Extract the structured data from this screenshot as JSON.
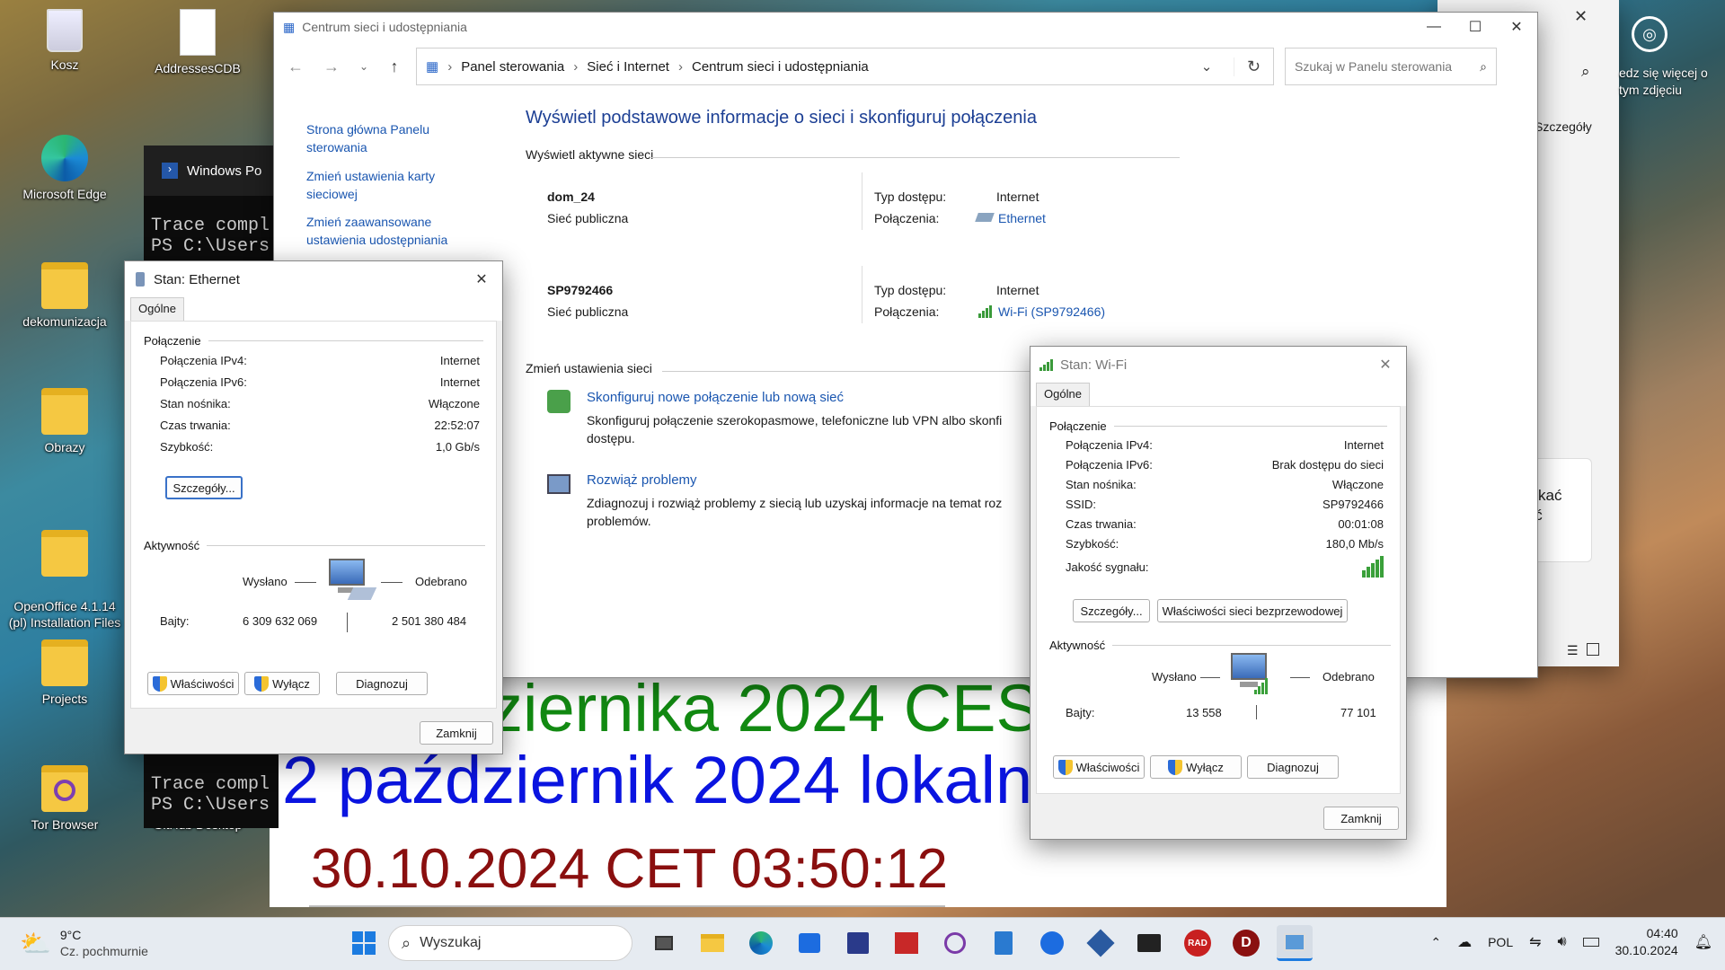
{
  "desktop": {
    "icons": [
      {
        "label": "Kosz",
        "icon": "recycle-bin-icon"
      },
      {
        "label": "AddressesCDB",
        "icon": "file-icon"
      },
      {
        "label": "Microsoft Edge",
        "icon": "edge-icon"
      },
      {
        "label": "dekomunizacja",
        "icon": "folder-icon"
      },
      {
        "label": "Obrazy",
        "icon": "folder-icon"
      },
      {
        "label": "OpenOffice 4.1.14\n(pl) Installation Files",
        "icon": "folder-icon"
      },
      {
        "label": "Projects",
        "icon": "folder-icon"
      },
      {
        "label": "Tor Browser",
        "icon": "tor-folder-icon"
      },
      {
        "label": "GitHub Desktop",
        "icon": "github-icon"
      }
    ],
    "spotlight": "edz się więcej o\ntym zdjęciu",
    "overlay_green": "ziernika 2024 CEST",
    "overlay_blue": "2 październik 2024 lokaln",
    "overlay_red": "30.10.2024 CET 03:50:12"
  },
  "powershell": {
    "title": "Windows Po",
    "line1": "Trace compl",
    "line2": "PS C:\\Users",
    "line3": "Trace compl",
    "line4": "PS C:\\Users"
  },
  "bg_window": {
    "details": "Szczegóły",
    "partial1": "yskać",
    "partial2": "nić"
  },
  "main": {
    "title": "Centrum sieci i udostępniania",
    "breadcrumb": [
      "Panel sterowania",
      "Sieć i Internet",
      "Centrum sieci i udostępniania"
    ],
    "search_placeholder": "Szukaj w Panelu sterowania",
    "sidebar": [
      "Strona główna Panelu sterowania",
      "Zmień ustawienia karty sieciowej",
      "Zmień zaawansowane ustawienia udostępniania"
    ],
    "heading": "Wyświetl podstawowe informacje o sieci i skonfiguruj połączenia",
    "active_label": "Wyświetl aktywne sieci",
    "access_label": "Typ dostępu:",
    "conn_label": "Połączenia:",
    "networks": [
      {
        "name": "dom_24",
        "type": "Sieć publiczna",
        "access": "Internet",
        "connection": "Ethernet"
      },
      {
        "name": "SP9792466",
        "type": "Sieć publiczna",
        "access": "Internet",
        "connection": "Wi-Fi (SP9792466)"
      }
    ],
    "change_label": "Zmień ustawienia sieci",
    "tasks": [
      {
        "title": "Skonfiguruj nowe połączenie lub nową sieć",
        "desc": "Skonfiguruj połączenie szerokopasmowe, telefoniczne lub VPN albo skonfi",
        "desc2": "dostępu."
      },
      {
        "title": "Rozwiąż problemy",
        "desc": "Zdiagnozuj i rozwiąż problemy z siecią lub uzyskaj informacje na temat roz",
        "desc2": "problemów."
      }
    ]
  },
  "eth": {
    "title": "Stan: Ethernet",
    "tab": "Ogólne",
    "conn_group": "Połączenie",
    "rows": [
      [
        "Połączenia IPv4:",
        "Internet"
      ],
      [
        "Połączenia IPv6:",
        "Internet"
      ],
      [
        "Stan nośnika:",
        "Włączone"
      ],
      [
        "Czas trwania:",
        "22:52:07"
      ],
      [
        "Szybkość:",
        "1,0 Gb/s"
      ]
    ],
    "details_btn": "Szczegóły...",
    "activity_group": "Aktywność",
    "sent": "Wysłano",
    "received": "Odebrano",
    "bytes_label": "Bajty:",
    "bytes_sent": "6 309 632 069",
    "bytes_recv": "2 501 380 484",
    "btn_props": "Właściwości",
    "btn_disable": "Wyłącz",
    "btn_diag": "Diagnozuj",
    "btn_close": "Zamknij"
  },
  "wifi": {
    "title": "Stan: Wi-Fi",
    "tab": "Ogólne",
    "conn_group": "Połączenie",
    "rows": [
      [
        "Połączenia IPv4:",
        "Internet"
      ],
      [
        "Połączenia IPv6:",
        "Brak dostępu do sieci"
      ],
      [
        "Stan nośnika:",
        "Włączone"
      ],
      [
        "SSID:",
        "SP9792466"
      ],
      [
        "Czas trwania:",
        "00:01:08"
      ],
      [
        "Szybkość:",
        "180,0 Mb/s"
      ]
    ],
    "signal_label": "Jakość sygnału:",
    "signal_bars": 5,
    "details_btn": "Szczegóły...",
    "wireless_btn": "Właściwości sieci bezprzewodowej",
    "activity_group": "Aktywność",
    "sent": "Wysłano",
    "received": "Odebrano",
    "bytes_label": "Bajty:",
    "bytes_sent": "13 558",
    "bytes_recv": "77 101",
    "btn_props": "Właściwości",
    "btn_disable": "Wyłącz",
    "btn_diag": "Diagnozuj",
    "btn_close": "Zamknij"
  },
  "taskbar": {
    "temp": "9°C",
    "weather": "Cz. pochmurnie",
    "search": "Wyszukaj",
    "lang": "POL",
    "time": "04:40",
    "date": "30.10.2024"
  },
  "colors": {
    "accent": "#1a56b0",
    "heading": "#1c3f94",
    "green_text": "#128a12",
    "blue_text": "#0a14e0",
    "red_text": "#8a0f0f"
  }
}
